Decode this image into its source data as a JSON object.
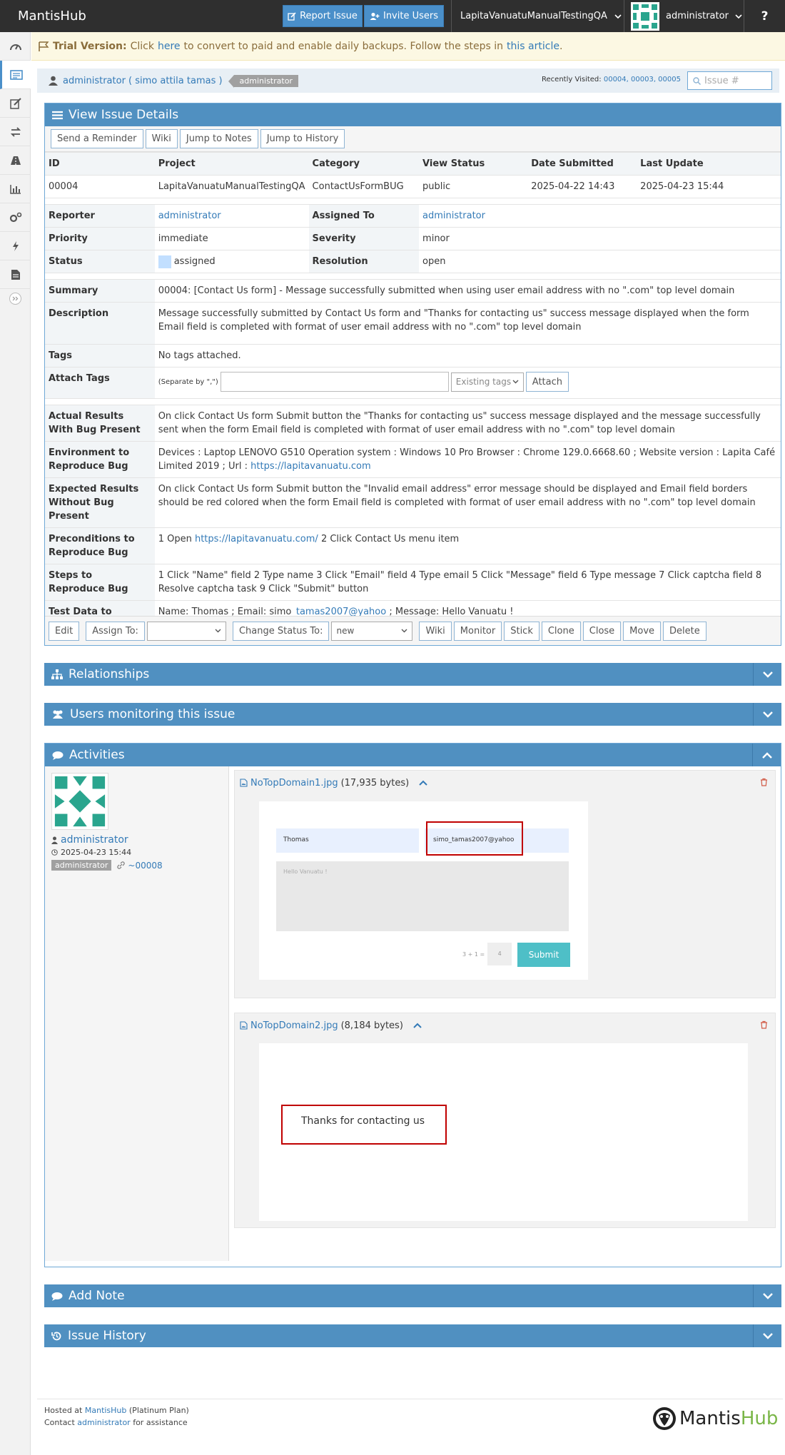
{
  "navbar": {
    "brand": "MantisHub",
    "report_issue": "Report Issue",
    "invite_users": "Invite Users",
    "project": "LapitaVanuatuManualTestingQA",
    "user": "administrator",
    "help": "?"
  },
  "trial": {
    "label": "Trial Version:",
    "text1": "Click",
    "link1": "here",
    "text2": "to convert to paid and enable daily backups. Follow the steps in",
    "link2": "this article",
    "text3": "."
  },
  "crumbs": {
    "user": "administrator ( simo attila tamas )",
    "badge": "administrator",
    "recent_label": "Recently Visited:",
    "recent_links": "00004, 00003, 00005",
    "search_placeholder": "Issue #"
  },
  "view": {
    "title": "View Issue Details",
    "buttons": [
      "Send a Reminder",
      "Wiki",
      "Jump to Notes",
      "Jump to History"
    ],
    "headers": [
      "ID",
      "Project",
      "Category",
      "View Status",
      "Date Submitted",
      "Last Update"
    ],
    "values": [
      "00004",
      "LapitaVanuatuManualTestingQA",
      "ContactUsFormBUG",
      "public",
      "2025-04-22 14:43",
      "2025-04-23 15:44"
    ],
    "reporter_label": "Reporter",
    "reporter": "administrator",
    "assigned_label": "Assigned To",
    "assigned": "administrator",
    "priority_label": "Priority",
    "priority": "immediate",
    "severity_label": "Severity",
    "severity": "minor",
    "status_label": "Status",
    "status": "assigned",
    "resolution_label": "Resolution",
    "resolution": "open",
    "summary_label": "Summary",
    "summary": "00004: [Contact Us form] - Message successfully submitted when using user email address with no \".com\" top level domain",
    "description_label": "Description",
    "description": "Message successfully submitted by Contact Us form and \"Thanks for contacting us\" success message displayed when the form Email field is completed with format of user email address with no \".com\" top level domain",
    "tags_label": "Tags",
    "tags": "No tags attached.",
    "attach_tags_label": "Attach Tags",
    "separate_hint": "(Separate by \",\")",
    "existing_tags": "Existing tags",
    "attach_button": "Attach",
    "actual_label": "Actual Results With Bug Present",
    "actual": "On click Contact Us form Submit button the \"Thanks for contacting us\" success message displayed and the message successfully sent when the form Email field is completed with format of user email address with no \".com\" top level domain",
    "env_label": "Environment to Reproduce Bug",
    "env": "Devices : Laptop LENOVO G510 Operation system : Windows 10 Pro Browser : Chrome 129.0.6668.60 ; Website version : Lapita Café Limited 2019 ; Url :",
    "env_link": "https://lapitavanuatu.com",
    "expected_label": "Expected Results Without Bug Present",
    "expected": "On click Contact Us form Submit button the \"Invalid email address\" error message should be displayed and Email field borders should be red colored when the form Email field is completed with format of user email address with no \".com\" top level domain",
    "precond_label": "Preconditions to Reproduce Bug",
    "precond_pre": "1 Open",
    "precond_link": "https://lapitavanuatu.com/",
    "precond_post": "2 Click Contact Us menu item",
    "steps_label": "Steps to Reproduce Bug",
    "steps": "1 Click \"Name\" field 2 Type name 3 Click \"Email\" field 4 Type email 5 Click \"Message\" field 6 Type message 7 Click captcha field 8 Resolve captcha task 9 Click \"Submit\" button",
    "testdata_label": "Test Data to Reproduce Bug",
    "testdata_pre": "Name: Thomas ; Email: simo_",
    "testdata_link": "tamas2007@yahoo",
    "testdata_post": "; Message: Hello Vanuatu !",
    "actions": {
      "edit": "Edit",
      "assign_to": "Assign To:",
      "change_status": "Change Status To:",
      "status_value": "new",
      "others": [
        "Wiki",
        "Monitor",
        "Stick",
        "Clone",
        "Close",
        "Move",
        "Delete"
      ]
    }
  },
  "sections": {
    "relationships": "Relationships",
    "monitoring": "Users monitoring this issue",
    "activities": "Activities",
    "add_note": "Add Note",
    "history": "Issue History"
  },
  "activity": {
    "user": "administrator",
    "date": "2025-04-23 15:44",
    "badge": "administrator",
    "note_link": "~00008",
    "att1_name": "NoTopDomain1.jpg",
    "att1_size": "(17,935 bytes)",
    "att2_name": "NoTopDomain2.jpg",
    "att2_size": "(8,184 bytes)",
    "shot1": {
      "name": "Thomas",
      "email": "simo_tamas2007@yahoo",
      "message": "Hello Vanuatu !",
      "captcha_q": "3 + 1 =",
      "captcha_a": "4",
      "submit": "Submit"
    },
    "shot2": {
      "thanks": "Thanks for contacting us"
    }
  },
  "footer": {
    "hosted_pre": "Hosted at",
    "hosted_link": "MantisHub",
    "hosted_post": "(Platinum Plan)",
    "contact_pre": "Contact",
    "contact_link": "administrator",
    "contact_post": "for assistance",
    "logo_a": "Mantis",
    "logo_b": "Hub"
  },
  "colors": {
    "navbar": "#2f2f2f",
    "widget_header": "#5090c1",
    "accent": "#4a8fc9",
    "trial_bg": "#fcf8e3",
    "status_assigned": "#c2dfff",
    "highlight_border": "#c00000",
    "submit_button": "#4ebfc7",
    "logo_green": "#7ab648"
  },
  "icons": [
    "dashboard-icon",
    "view-issues-icon",
    "report-icon",
    "changelog-icon",
    "roadmap-icon",
    "summary-icon",
    "manage-icon",
    "time-icon",
    "docs-icon"
  ]
}
